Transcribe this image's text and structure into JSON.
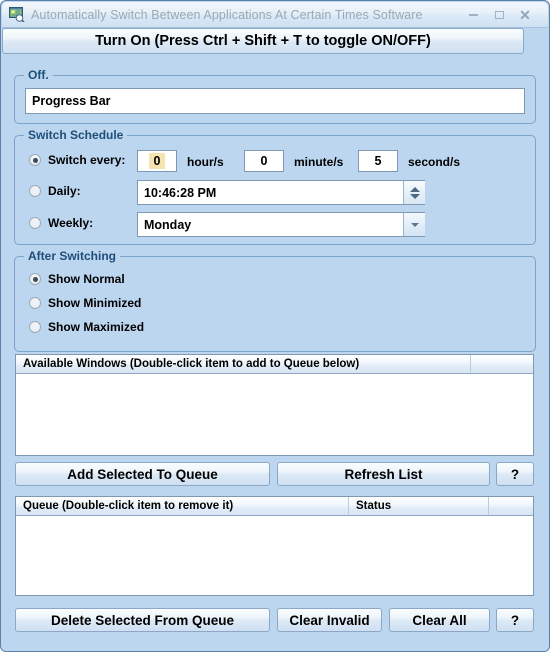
{
  "window": {
    "title": "Automatically Switch Between Applications At Certain Times Software",
    "icon": "app-icon",
    "controls": {
      "minimize": "minimize-icon",
      "maximize": "maximize-icon",
      "close": "close-icon"
    }
  },
  "toggle_button": {
    "label": "Turn On (Press Ctrl + Shift + T to toggle ON/OFF)"
  },
  "status_group": {
    "title": "Off.",
    "field_value": "Progress Bar"
  },
  "switch_schedule": {
    "title": "Switch Schedule",
    "options": [
      {
        "label": "Switch every:",
        "checked": true
      },
      {
        "label": "Daily:",
        "checked": false
      },
      {
        "label": "Weekly:",
        "checked": false
      }
    ],
    "interval": {
      "hours": "0",
      "hours_unit": "hour/s",
      "minutes": "0",
      "minutes_unit": "minute/s",
      "seconds": "5",
      "seconds_unit": "second/s"
    },
    "daily_time": "10:46:28 PM",
    "weekly_day": "Monday"
  },
  "after_switching": {
    "title": "After Switching",
    "options": [
      {
        "label": "Show Normal",
        "checked": true
      },
      {
        "label": "Show Minimized",
        "checked": false
      },
      {
        "label": "Show Maximized",
        "checked": false
      }
    ]
  },
  "available_windows": {
    "columns": [
      "Available Windows (Double-click item to add to Queue below)",
      ""
    ],
    "rows": []
  },
  "available_buttons": {
    "add_to_queue": "Add Selected To Queue",
    "refresh_list": "Refresh List",
    "help": "?"
  },
  "queue": {
    "columns": [
      "Queue (Double-click item to remove it)",
      "Status",
      ""
    ],
    "rows": []
  },
  "queue_buttons": {
    "delete_selected": "Delete Selected From Queue",
    "clear_invalid": "Clear Invalid",
    "clear_all": "Clear All",
    "help": "?"
  },
  "colors": {
    "window_bg": "#bcd6ef",
    "group_border": "#7ea3c8",
    "group_title": "#1f4e79",
    "title_text": "#9aa8b5",
    "selection_highlight": "#f5e3b0"
  }
}
